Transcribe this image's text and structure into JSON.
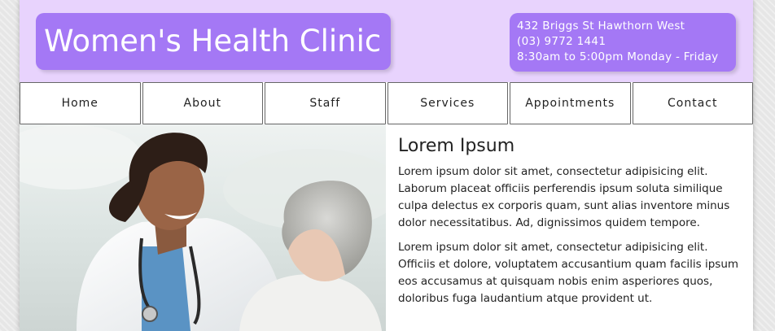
{
  "header": {
    "title": "Women's Health Clinic",
    "address": "432 Briggs St Hawthorn West",
    "phone": "(03) 9772 1441",
    "hours": "8:30am to 5:00pm Monday - Friday"
  },
  "nav": {
    "items": [
      "Home",
      "About",
      "Staff",
      "Services",
      "Appointments",
      "Contact"
    ]
  },
  "main": {
    "heading": "Lorem Ipsum",
    "paragraph1": "Lorem ipsum dolor sit amet, consectetur adipisicing elit. Laborum placeat officiis perferendis ipsum soluta similique culpa delectus ex corporis quam, sunt alias inventore minus dolor necessitatibus. Ad, dignissimos quidem tempore.",
    "paragraph2": "Lorem ipsum dolor sit amet, consectetur adipisicing elit. Officiis et dolore, voluptatem accusantium quam facilis ipsum eos accusamus at quisquam nobis enim asperiores quos, doloribus fuga laudantium atque provident ut."
  },
  "colors": {
    "header_bg": "#e8d3fd",
    "accent": "#a478f5"
  },
  "hero_image": "doctor-with-patient-photo"
}
